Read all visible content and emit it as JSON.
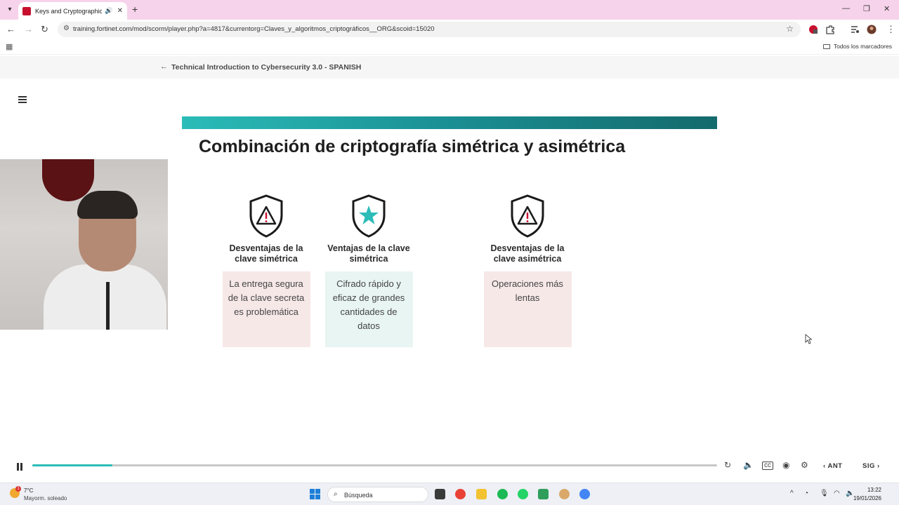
{
  "browser": {
    "tab_title": "Keys and Cryptographic Algorithms",
    "tab_audio_icon": "speaker-icon",
    "url": "training.fortinet.com/mod/scorm/player.php?a=4817&currentorg=Claves_y_algoritmos_criptográficos__ORG&scoid=15020",
    "bookmarks_label": "Todos los marcadores"
  },
  "course": {
    "title": "Technical Introduction to Cybersecurity 3.0 - SPANISH"
  },
  "slide": {
    "title": "Combinación de criptografía simétrica y asimétrica",
    "cards": [
      {
        "icon": "warning-shield-icon",
        "heading": "Desventajas de la clave simétrica",
        "body": "La entrega segura de la clave secreta es problemática",
        "color": "#f7e8e8"
      },
      {
        "icon": "star-shield-icon",
        "heading": "Ventajas de la clave simétrica",
        "body": "Cifrado rápido y eficaz de grandes cantidades de datos",
        "color": "#e8f5f2"
      },
      {
        "icon": "warning-shield-icon",
        "heading": "Desventajas de la clave asimétrica",
        "body": "Operaciones más lentas",
        "color": "#f7e8e8"
      }
    ]
  },
  "player": {
    "progress": 0.117,
    "prev_label": "ANT",
    "next_label": "SIG"
  },
  "taskbar": {
    "weather_temp": "7°C",
    "weather_desc": "Mayorm. soleado",
    "weather_badge": "1",
    "search_label": "Búsqueda",
    "time": "13:22",
    "date": "19/01/2026"
  },
  "colors": {
    "accent": "#2bbcb8",
    "brand_bar_end": "#146a6c",
    "warning_red": "#c8102e"
  }
}
